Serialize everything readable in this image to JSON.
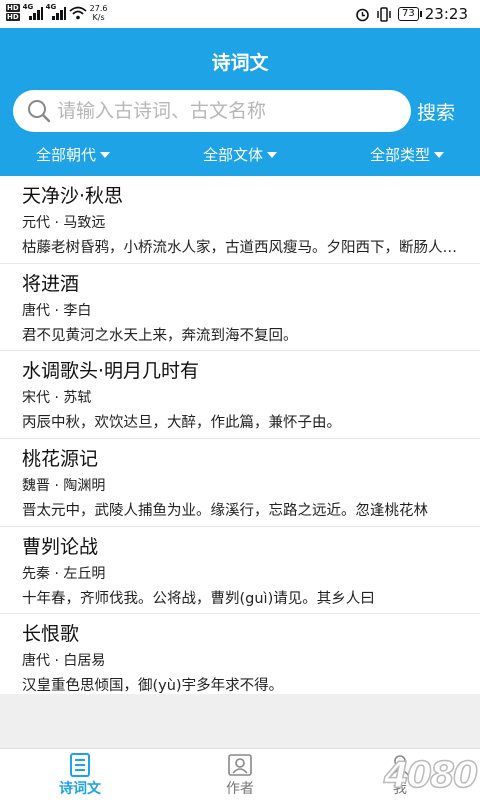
{
  "status_bar": {
    "net_speed": "27.6",
    "net_unit": "K/s",
    "battery": "73",
    "time": "23:23"
  },
  "header": {
    "title": "诗词文",
    "search_placeholder": "请输入古诗词、古文名称",
    "search_button": "搜索",
    "filters": [
      "全部朝代",
      "全部文体",
      "全部类型"
    ]
  },
  "items": [
    {
      "title": "天净沙·秋思",
      "author": "元代 · 马致远",
      "excerpt": "枯藤老树昏鸦，小桥流水人家，古道西风瘦马。夕阳西下，断肠人在天涯。"
    },
    {
      "title": "将进酒",
      "author": "唐代 · 李白",
      "excerpt": "君不见黄河之水天上来，奔流到海不复回。"
    },
    {
      "title": "水调歌头·明月几时有",
      "author": "宋代 · 苏轼",
      "excerpt": "丙辰中秋，欢饮达旦，大醉，作此篇，兼怀子由。"
    },
    {
      "title": "桃花源记",
      "author": "魏晋 · 陶渊明",
      "excerpt": "晋太元中，武陵人捕鱼为业。缘溪行，忘路之远近。忽逢桃花林"
    },
    {
      "title": "曹刿论战",
      "author": "先秦 · 左丘明",
      "excerpt": "十年春，齐师伐我。公将战，曹刿(guì)请见。其乡人曰"
    },
    {
      "title": "长恨歌",
      "author": "唐代 · 白居易",
      "excerpt": "汉皇重色思倾国，御(yù)宇多年求不得。"
    }
  ],
  "tabs": [
    {
      "label": "诗词文",
      "icon": "document-icon",
      "active": true
    },
    {
      "label": "作者",
      "icon": "person-card-icon",
      "active": false
    },
    {
      "label": "我",
      "icon": "user-icon",
      "active": false
    }
  ],
  "colors": {
    "accent": "#1da3e6"
  },
  "watermark": "4080"
}
